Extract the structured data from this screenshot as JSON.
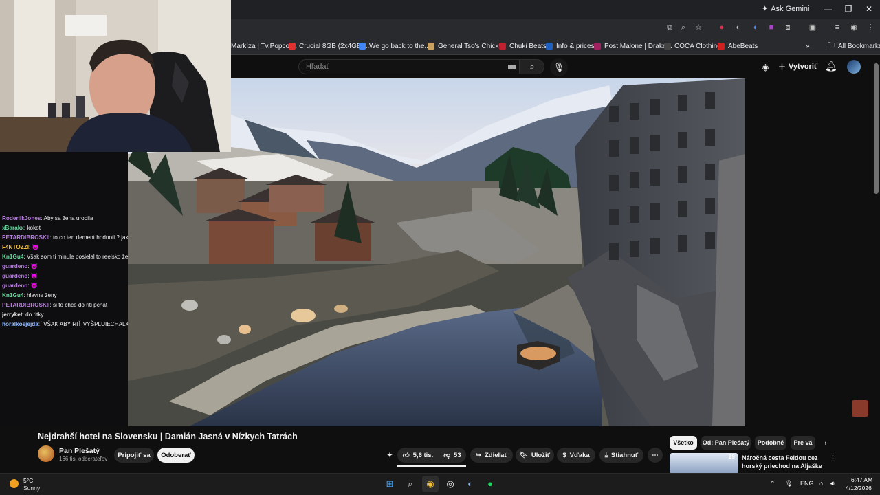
{
  "browser": {
    "ask_gemini": "Ask Gemini",
    "all_bookmarks": "All Bookmarks",
    "bookmarks": [
      {
        "label": "Markíza | Tv.Popcor...",
        "color": "#888888"
      },
      {
        "label": "Crucial 8GB (2x4GB)...",
        "color": "#e03030"
      },
      {
        "label": "We go back to the...",
        "color": "#4285f4"
      },
      {
        "label": "General Tso's Chick...",
        "color": "#c8a060"
      },
      {
        "label": "Chuki Beats",
        "color": "#c02030"
      },
      {
        "label": "Info & prices",
        "color": "#2060c0"
      },
      {
        "label": "Post Malone | Drake...",
        "color": "#a02060"
      },
      {
        "label": "COCA Clothing",
        "color": "#444444"
      },
      {
        "label": "AbeBeats",
        "color": "#d02020"
      }
    ]
  },
  "youtube": {
    "search_placeholder": "Hľadať",
    "create_label": "Vytvoriť",
    "video_title": "Nejdrahší hotel na Slovensku | Damián Jasná v Nízkych Tatrách",
    "channel_name": "Pan Plešatý",
    "channel_subs": "166 tis. odberateľov",
    "join_label": "Pripojiť sa",
    "subscribe_label": "Odoberať",
    "like_count": "5,6 tis.",
    "dislike_count": "53",
    "share_label": "Zdieľať",
    "save_label": "Uložiť",
    "thanks_label": "Vďaka",
    "download_label": "Stiahnuť",
    "chips": [
      "Všetko",
      "Od: Pan Plešatý",
      "Podobné",
      "Pre vá"
    ],
    "rec_badge": "29",
    "rec_title": "Náročná cesta Feldou cez horský priechod na Aljaške na ..."
  },
  "chat": [
    {
      "user": "RoderiikJones",
      "color": "#b57edc",
      "text": ": Aby sa žena urobila"
    },
    {
      "user": "xBarakx",
      "color": "#6ad29a",
      "text": ": kokot"
    },
    {
      "user": "PETARDIBROSKII",
      "color": "#b57edc",
      "text": ": to co ten dement hodnoti ? jaky tlak ma hlavicaa ?"
    },
    {
      "user": "F4NTOZZI",
      "color": "#f0c040",
      "text": ": 😈"
    },
    {
      "user": "Kn1Gu4",
      "color": "#6ad29a",
      "text": ": Však som ti minule posielal to reelsko že prečo"
    },
    {
      "user": "guardeno",
      "color": "#b57edc",
      "text": ": 😈"
    },
    {
      "user": "guardeno",
      "color": "#b57edc",
      "text": ": 😈"
    },
    {
      "user": "guardeno",
      "color": "#b57edc",
      "text": ": 😈"
    },
    {
      "user": "Kn1Gu4",
      "color": "#6ad29a",
      "text": ": hlavne ženy"
    },
    {
      "user": "PETARDIBROSKII",
      "color": "#b57edc",
      "text": ": si to chce do riti pchat"
    },
    {
      "user": "jerryket",
      "color": "#efeff1",
      "text": ": do ritky"
    },
    {
      "user": "horalkosjejda",
      "color": "#8fb8ff",
      "text": ": ˇVŠAK ABY RIŤ VYŠPLUIECHALK"
    }
  ],
  "taskbar": {
    "temp": "5°C",
    "weather": "Sunny",
    "lang": "ENG",
    "time": "6:47 AM",
    "date": "4/12/2026"
  }
}
